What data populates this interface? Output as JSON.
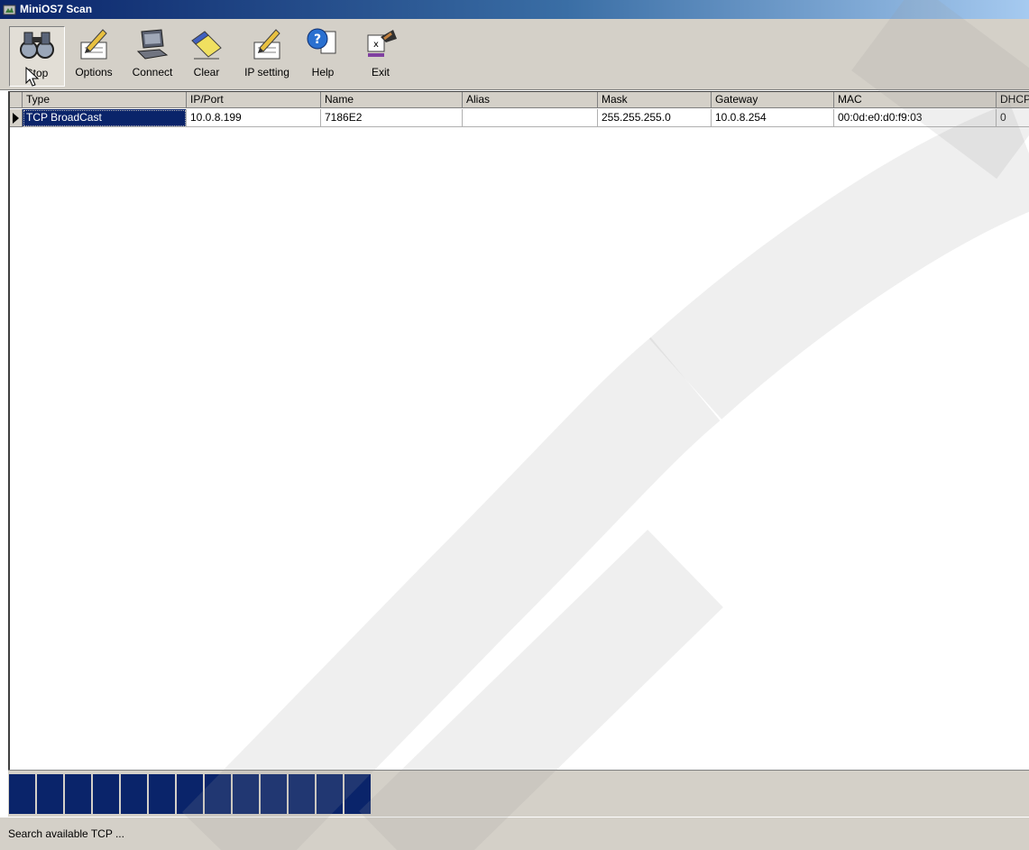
{
  "window": {
    "title": "MiniOS7 Scan"
  },
  "toolbar": {
    "buttons": [
      {
        "label": "Stop",
        "icon": "binoculars-icon",
        "pressed": true
      },
      {
        "label": "Options",
        "icon": "pen-paper-icon"
      },
      {
        "label": "Connect",
        "icon": "computer-icon"
      },
      {
        "label": "Clear",
        "icon": "eraser-icon"
      },
      {
        "label": "IP setting",
        "icon": "pen-paper-icon"
      },
      {
        "label": "Help",
        "icon": "help-icon"
      },
      {
        "label": "Exit",
        "icon": "exit-icon"
      }
    ]
  },
  "table": {
    "columns": [
      "Type",
      "IP/Port",
      "Name",
      "Alias",
      "Mask",
      "Gateway",
      "MAC",
      "DHCP"
    ],
    "rows": [
      [
        "TCP BroadCast",
        "10.0.8.199",
        "7186E2",
        "",
        "255.255.255.0",
        "10.0.8.254",
        "00:0d:e0:d0:f9:03",
        "0"
      ]
    ]
  },
  "progress": {
    "filled_blocks": 13
  },
  "status": {
    "text": "Search available TCP ..."
  },
  "colors": {
    "selection": "#0a246a",
    "face": "#d4d0c8",
    "progress": "#0a246a"
  }
}
